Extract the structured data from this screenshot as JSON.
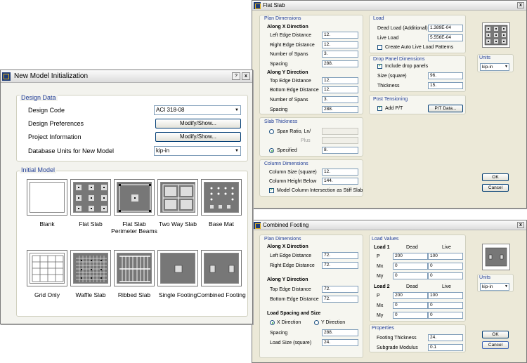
{
  "new_model": {
    "title": "New Model Initialization",
    "help_btn": "?",
    "close_btn": "x",
    "design_data": {
      "legend": "Design Data",
      "design_code_label": "Design Code",
      "design_code_value": "ACI 318-08",
      "design_prefs_label": "Design Preferences",
      "design_prefs_btn": "Modify/Show...",
      "project_info_label": "Project Information",
      "project_info_btn": "Modify/Show...",
      "db_units_label": "Database Units for New Model",
      "db_units_value": "kip-in"
    },
    "initial_model": {
      "legend": "Initial Model",
      "tiles": [
        {
          "label": "Blank"
        },
        {
          "label": "Flat Slab"
        },
        {
          "label": "Flat Slab Perimeter Beams"
        },
        {
          "label": "Two Way Slab"
        },
        {
          "label": "Base Mat"
        },
        {
          "label": "Grid Only"
        },
        {
          "label": "Waffle Slab"
        },
        {
          "label": "Ribbed Slab"
        },
        {
          "label": "Single Footing"
        },
        {
          "label": "Combined Footing"
        }
      ]
    }
  },
  "flat_slab": {
    "title": "Flat Slab",
    "plan_dimensions": {
      "legend": "Plan Dimensions",
      "x_header": "Along X Direction",
      "left_edge_label": "Left Edge Distance",
      "left_edge": "12.",
      "right_edge_label": "Right Edge Distance",
      "right_edge": "12.",
      "x_spans_label": "Number of Spans",
      "x_spans": "3.",
      "x_spacing_label": "Spacing",
      "x_spacing": "288.",
      "y_header": "Along Y Direction",
      "top_edge_label": "Top Edge Distance",
      "top_edge": "12.",
      "bottom_edge_label": "Bottom Edge Distance",
      "bottom_edge": "12.",
      "y_spans_label": "Number of Spans",
      "y_spans": "3.",
      "y_spacing_label": "Spacing",
      "y_spacing": "288."
    },
    "slab_thickness": {
      "legend": "Slab Thickness",
      "span_ratio_label": "Span Ratio, Ln/",
      "plus_label": "Plus",
      "specified_label": "Specified",
      "specified_value": "8."
    },
    "column_dimensions": {
      "legend": "Column Dimensions",
      "col_size_label": "Column Size (square)",
      "col_size": "12.",
      "col_height_label": "Column Height Below",
      "col_height": "144.",
      "stiff_label": "Model Column Intersection as Stiff Slab"
    },
    "load": {
      "legend": "Load",
      "dead_label": "Dead Load (Additional)",
      "dead": "1.389E-04",
      "live_label": "Live Load",
      "live": "5.556E-04",
      "auto_label": "Create Auto Live Load Patterns"
    },
    "drop_panel": {
      "legend": "Drop Panel Dimensions",
      "include_label": "Include drop panels",
      "size_label": "Size (square)",
      "size": "96.",
      "thickness_label": "Thickness",
      "thickness": "15."
    },
    "post_tensioning": {
      "legend": "Post Tensioning",
      "add_pt_label": "Add P/T",
      "pt_btn": "P/T Data..."
    },
    "units": {
      "legend": "Units",
      "value": "kip-in"
    },
    "ok": "OK",
    "cancel": "Cancel"
  },
  "combined_footing": {
    "title": "Combined Footing",
    "plan_dimensions": {
      "legend": "Plan Dimensions",
      "x_header": "Along X Direction",
      "left_edge_label": "Left Edge Distance",
      "left_edge": "72.",
      "right_edge_label": "Right Edge Distance",
      "right_edge": "72.",
      "y_header": "Along Y Direction",
      "top_edge_label": "Top Edge Distance",
      "top_edge": "72.",
      "bottom_edge_label": "Bottom Edge Distance",
      "bottom_edge": "72.",
      "spacing_header": "Load Spacing and Size",
      "x_dir_label": "X Direction",
      "y_dir_label": "Y Direction",
      "spacing_label": "Spacing",
      "spacing": "288.",
      "load_size_label": "Load Size (square)",
      "load_size": "24."
    },
    "load_values": {
      "legend": "Load Values",
      "load1_label": "Load 1",
      "load2_label": "Load 2",
      "dead_hdr": "Dead",
      "live_hdr": "Live",
      "p_label": "P",
      "mx_label": "Mx",
      "my_label": "My",
      "load1": {
        "p_dead": "200",
        "p_live": "100",
        "mx_dead": "0",
        "mx_live": "0",
        "my_dead": "0",
        "my_live": "0"
      },
      "load2": {
        "p_dead": "200",
        "p_live": "100",
        "mx_dead": "0",
        "mx_live": "0",
        "my_dead": "0",
        "my_live": "0"
      }
    },
    "properties": {
      "legend": "Properties",
      "thickness_label": "Footing Thickness",
      "thickness": "24.",
      "subgrade_label": "Subgrade Modulus",
      "subgrade": "0.1"
    },
    "units": {
      "legend": "Units",
      "value": "kip-in"
    },
    "ok": "OK",
    "cancel": "Cancel"
  }
}
